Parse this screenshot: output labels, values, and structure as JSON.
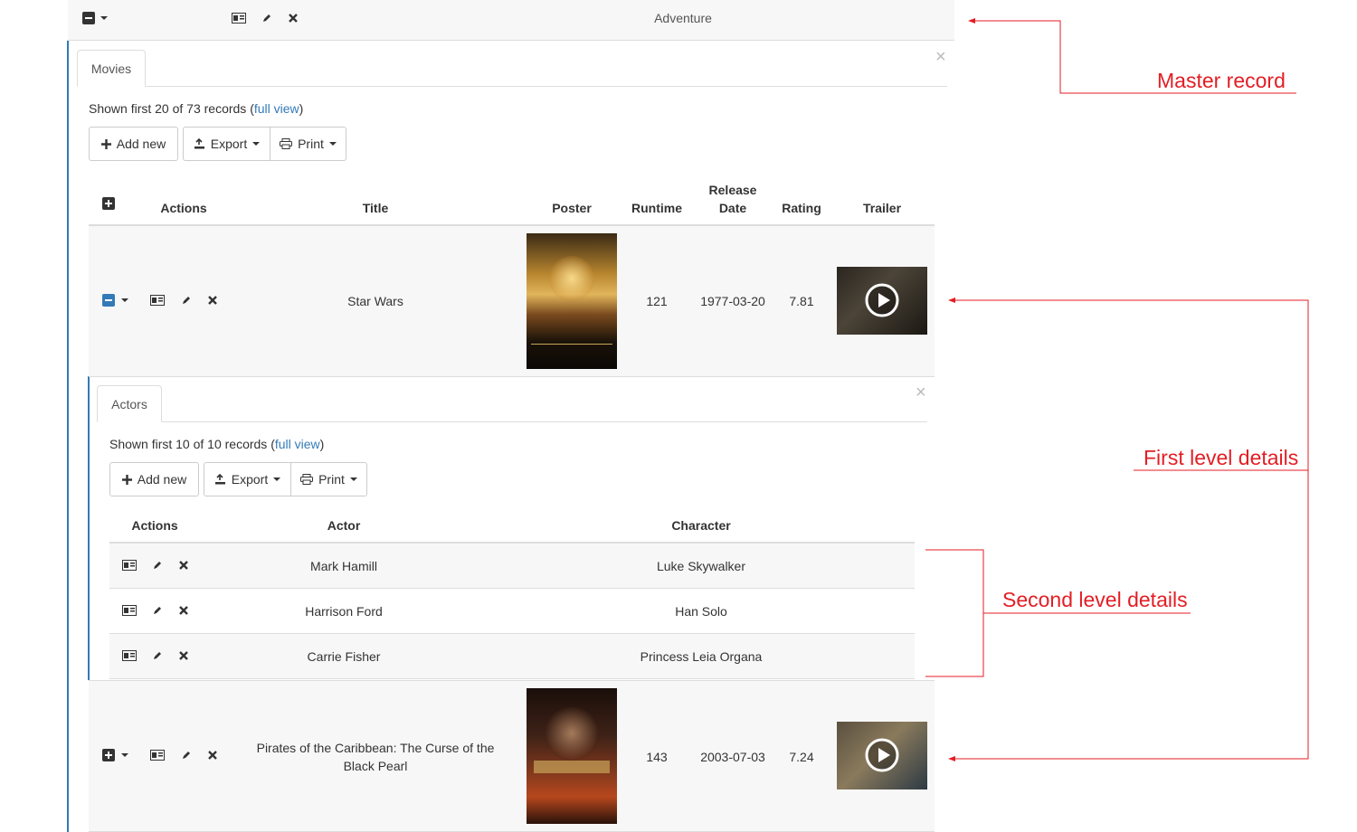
{
  "master": {
    "genre": "Adventure"
  },
  "movies_panel": {
    "tab_label": "Movies",
    "close": "×",
    "summary_prefix": "Shown first 20 of 73 records (",
    "summary_link": "full view",
    "summary_suffix": ")",
    "toolbar": {
      "add_label": "Add new",
      "export_label": "Export",
      "print_label": "Print"
    },
    "headers": {
      "actions": "Actions",
      "title": "Title",
      "poster": "Poster",
      "runtime": "Runtime",
      "release_line1": "Release",
      "release_line2": "Date",
      "rating": "Rating",
      "trailer": "Trailer"
    },
    "rows": [
      {
        "title": "Star Wars",
        "runtime": "121",
        "release": "1977-03-20",
        "rating": "7.81"
      },
      {
        "title": "Pirates of the Caribbean: The Curse of the Black Pearl",
        "runtime": "143",
        "release": "2003-07-03",
        "rating": "7.24"
      }
    ]
  },
  "actors_panel": {
    "tab_label": "Actors",
    "close": "×",
    "summary_prefix": "Shown first 10 of 10 records (",
    "summary_link": "full view",
    "summary_suffix": ")",
    "toolbar": {
      "add_label": "Add new",
      "export_label": "Export",
      "print_label": "Print"
    },
    "headers": {
      "actions": "Actions",
      "actor": "Actor",
      "character": "Character"
    },
    "rows": [
      {
        "actor": "Mark Hamill",
        "character": "Luke Skywalker"
      },
      {
        "actor": "Harrison Ford",
        "character": "Han Solo"
      },
      {
        "actor": "Carrie Fisher",
        "character": "Princess Leia Organa"
      }
    ]
  },
  "annotations": {
    "master": "Master record",
    "first_level": "First level details",
    "second_level": "Second level details"
  },
  "colors": {
    "accent": "#337ab7",
    "annotation": "#e31e24",
    "row_bg": "#f7f7f7",
    "border": "#dddddd"
  },
  "icons": [
    "collapse-icon",
    "expand-icon",
    "caret-down-icon",
    "view-card-icon",
    "edit-pencil-icon",
    "delete-x-icon",
    "plus-icon",
    "export-icon",
    "print-icon",
    "play-icon",
    "close-icon"
  ]
}
